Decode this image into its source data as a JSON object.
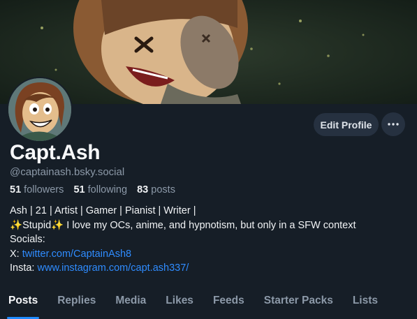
{
  "profile": {
    "display_name": "Capt.Ash",
    "handle": "@captainash.bsky.social",
    "followers_count": "51",
    "followers_label": "followers",
    "following_count": "51",
    "following_label": "following",
    "posts_count": "83",
    "posts_label": "posts"
  },
  "actions": {
    "edit_profile_label": "Edit Profile",
    "more_icon": "ellipsis-icon"
  },
  "bio": {
    "line1": "Ash | 21 | Artist | Gamer | Pianist | Writer |",
    "line2_spark_left": "✨",
    "line2_stupid": "Stupid",
    "line2_spark_right": "✨",
    "line2_rest": " I love my OCs, anime, and hypnotism, but only in a SFW context",
    "line3": "Socials:",
    "line4_prefix": "X: ",
    "line4_link": "twitter.com/CaptainAsh8",
    "line5_prefix": "Insta: ",
    "line5_link": "www.instagram.com/capt.ash337/"
  },
  "tabs": [
    {
      "label": "Posts",
      "active": true
    },
    {
      "label": "Replies"
    },
    {
      "label": "Media"
    },
    {
      "label": "Likes"
    },
    {
      "label": "Feeds"
    },
    {
      "label": "Starter Packs"
    },
    {
      "label": "Lists"
    }
  ],
  "colors": {
    "background": "#161e27",
    "accent": "#208bfe",
    "link": "#2f8cff",
    "muted": "#8c99a8",
    "button": "#263140"
  }
}
